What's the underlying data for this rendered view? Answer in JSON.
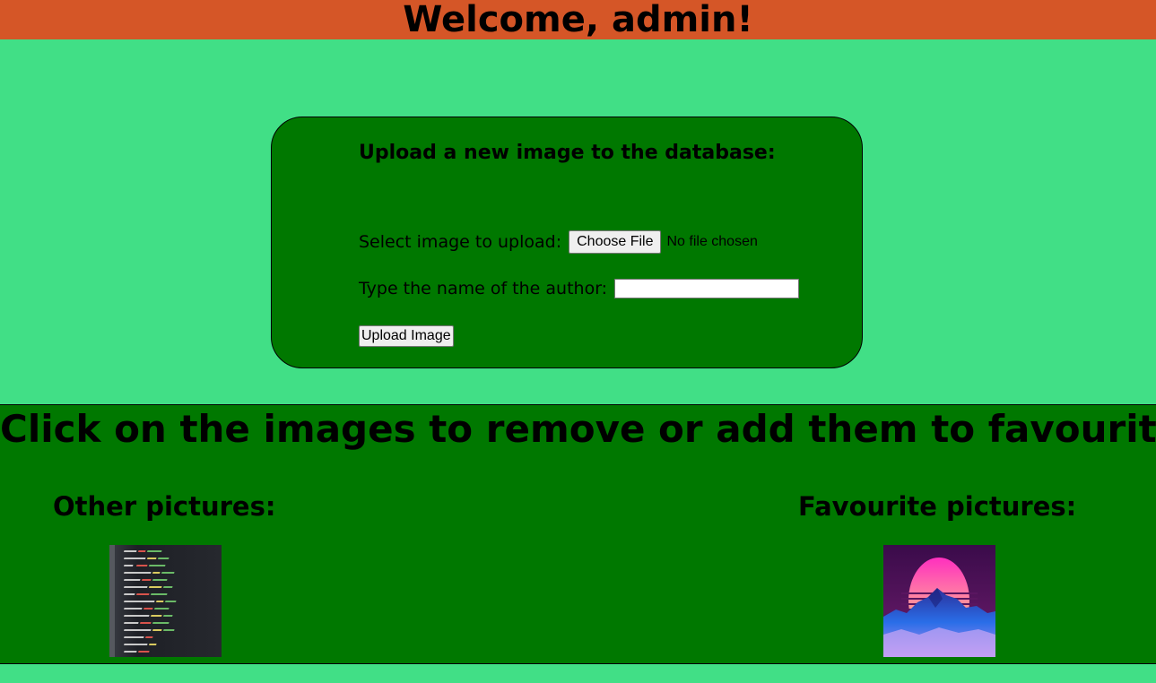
{
  "header": {
    "title": "Welcome, admin!"
  },
  "upload": {
    "title": "Upload a new image to the database:",
    "select_label": "Select image to upload:",
    "choose_file_label": "Choose File",
    "file_status": "No file chosen",
    "author_label": "Type the name of the author:",
    "author_value": "",
    "submit_label": "Upload Image"
  },
  "gallery": {
    "title": "Click on the images to remove or add them to favourites",
    "other": {
      "title": "Other pictures:",
      "images": [
        {
          "name": "code-screenshot-thumbnail"
        }
      ]
    },
    "favourites": {
      "title": "Favourite pictures:",
      "images": [
        {
          "name": "synthwave-mountain-thumbnail"
        }
      ]
    }
  },
  "colors": {
    "page_bg": "#41df86",
    "header_bg": "#d55627",
    "panel_bg": "#007800"
  }
}
